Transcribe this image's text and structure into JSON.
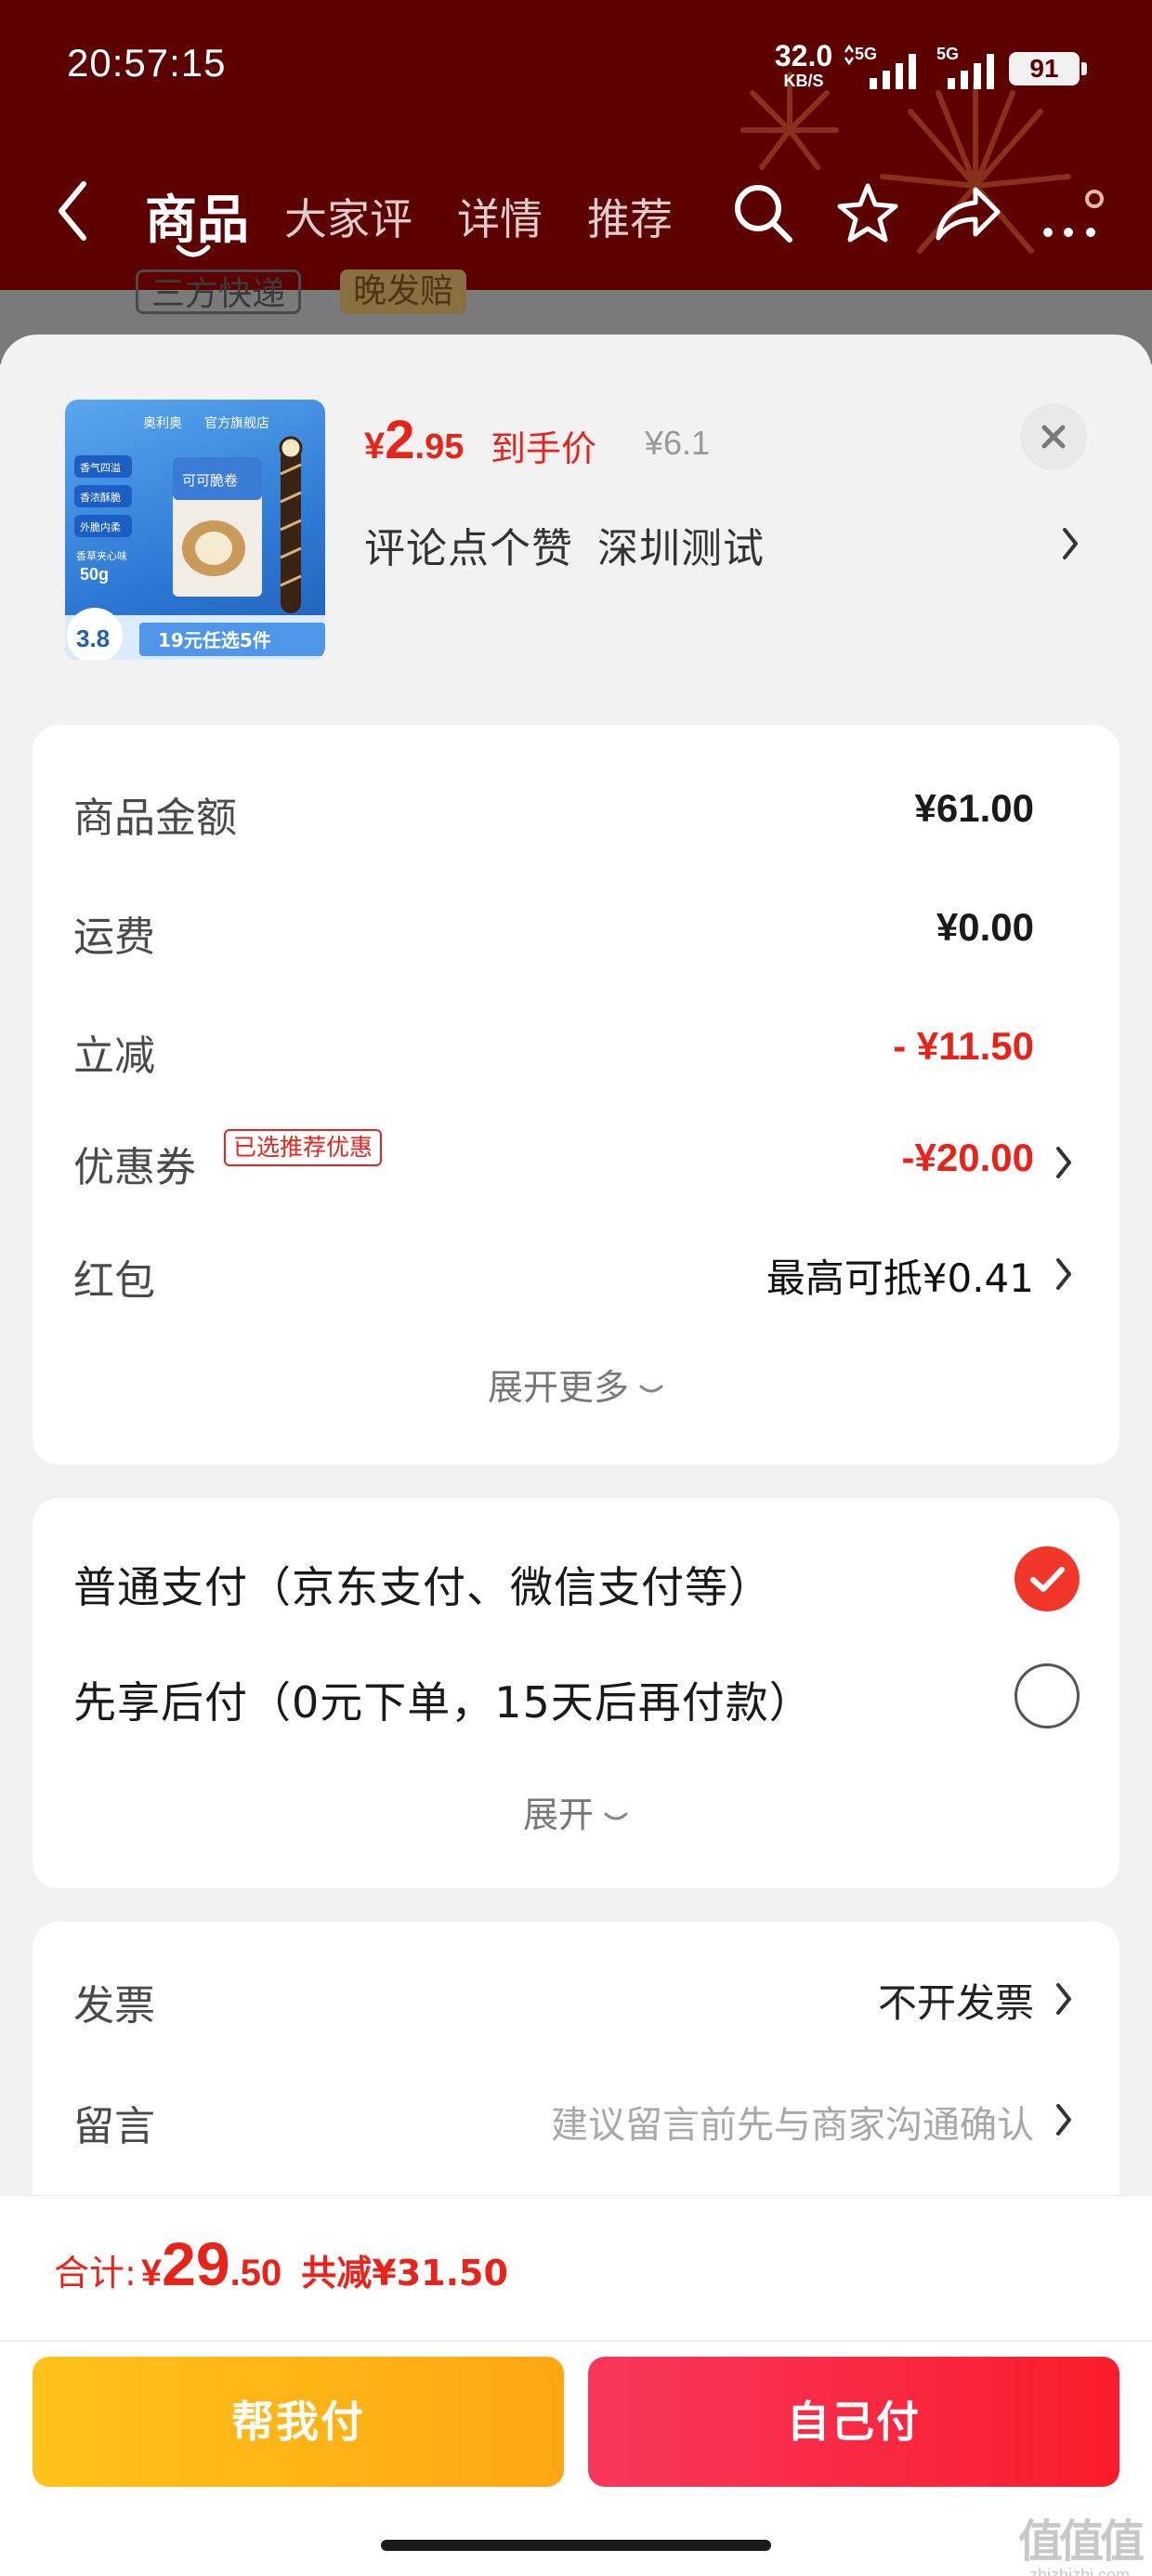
{
  "status_bar": {
    "time": "20:57:15",
    "net_speed_value": "32.0",
    "net_speed_unit": "KB/S",
    "signal_1_label": "5G",
    "signal_2_label": "5G",
    "battery": "91"
  },
  "nav": {
    "tabs": [
      {
        "label": "商品",
        "active": true
      },
      {
        "label": "大家评",
        "active": false
      },
      {
        "label": "详情",
        "active": false
      },
      {
        "label": "推荐",
        "active": false
      }
    ],
    "icons": [
      "back-icon",
      "search-icon",
      "star-icon",
      "share-icon",
      "more-icon"
    ]
  },
  "background_tags": {
    "tag_1": "三方快递",
    "tag_2": "晚发赔"
  },
  "product": {
    "image_texts": {
      "brand": "奥利奥",
      "store": "官方旗舰店",
      "features": [
        "香气四溢",
        "香浓酥脆",
        "外脆内柔"
      ],
      "flavor": "香草夹心味",
      "weight": "50g",
      "box_label": "可可脆卷",
      "price_tag": "3.8",
      "promo": "19元任选5件"
    },
    "price_symbol": "¥",
    "price_int": "2",
    "price_dec": ".95",
    "price_label": "到手价",
    "original_price": "¥6.1",
    "spec_part_1": "评论点个赞",
    "spec_part_2": "深圳测试"
  },
  "cost_summary": {
    "rows": [
      {
        "label": "商品金额",
        "value": "¥61.00"
      },
      {
        "label": "运费",
        "value": "¥0.00"
      },
      {
        "label": "立减",
        "value": "- ¥11.50"
      },
      {
        "label": "优惠券",
        "tag": "已选推荐优惠",
        "value": "-¥20.00"
      },
      {
        "label": "红包",
        "value": "最高可抵¥0.41"
      }
    ],
    "expand_label": "展开更多"
  },
  "payment": {
    "options": [
      {
        "label": "普通支付（京东支付、微信支付等）",
        "selected": true
      },
      {
        "label": "先享后付（0元下单，15天后再付款）",
        "selected": false
      }
    ],
    "expand_label": "展开"
  },
  "extras": {
    "invoice_label": "发票",
    "invoice_value": "不开发票",
    "message_label": "留言",
    "message_placeholder": "建议留言前先与商家沟通确认"
  },
  "bottom": {
    "total_label": "合计:",
    "total_symbol": "¥",
    "total_int": "29",
    "total_dec": ".50",
    "total_saved": "共减¥31.50",
    "help_pay_label": "帮我付",
    "self_pay_label": "自己付"
  },
  "watermark": {
    "logo": "值值值",
    "url": "zhizhizhi.com"
  },
  "colors": {
    "header_bg": "#5c0000",
    "accent_red": "#e8231a",
    "help_button": "#ffb516",
    "self_button": "#f92a42"
  }
}
